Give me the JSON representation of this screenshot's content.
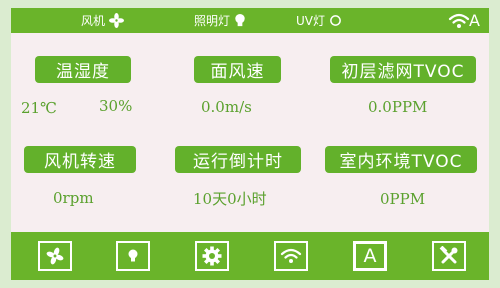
{
  "status_bar": {
    "fan_label": "风机",
    "fan_icon": "fan-icon",
    "light_label": "照明灯",
    "light_icon": "bulb-icon",
    "uv_label": "UV灯",
    "uv_icon": "circle-icon",
    "wifi_icon": "wifi-icon",
    "mode_letter": "A"
  },
  "panels": {
    "temp_humidity": {
      "label": "温湿度",
      "temperature": "21℃",
      "humidity": "30%"
    },
    "wind_speed": {
      "label": "面风速",
      "value": "0.0m/s"
    },
    "tvoc_primary": {
      "label": "初层滤网TVOC",
      "value": "0.0PPM"
    },
    "fan_speed": {
      "label": "风机转速",
      "value": "0rpm"
    },
    "countdown": {
      "label": "运行倒计时",
      "value": "10天0小时"
    },
    "tvoc_indoor": {
      "label": "室内环境TVOC",
      "value": "0PPM"
    }
  },
  "bottom_nav": {
    "buttons": [
      {
        "icon": "fan-icon"
      },
      {
        "icon": "bulb-icon"
      },
      {
        "icon": "gear-icon"
      },
      {
        "icon": "wifi-icon"
      },
      {
        "icon": "auto-icon",
        "letter": "A"
      },
      {
        "icon": "tools-icon"
      }
    ]
  },
  "colors": {
    "accent": "#6ab42a",
    "value_text": "#5ba12e",
    "panel_bg": "#f7eef0",
    "outer_bg": "#dbecd0"
  }
}
